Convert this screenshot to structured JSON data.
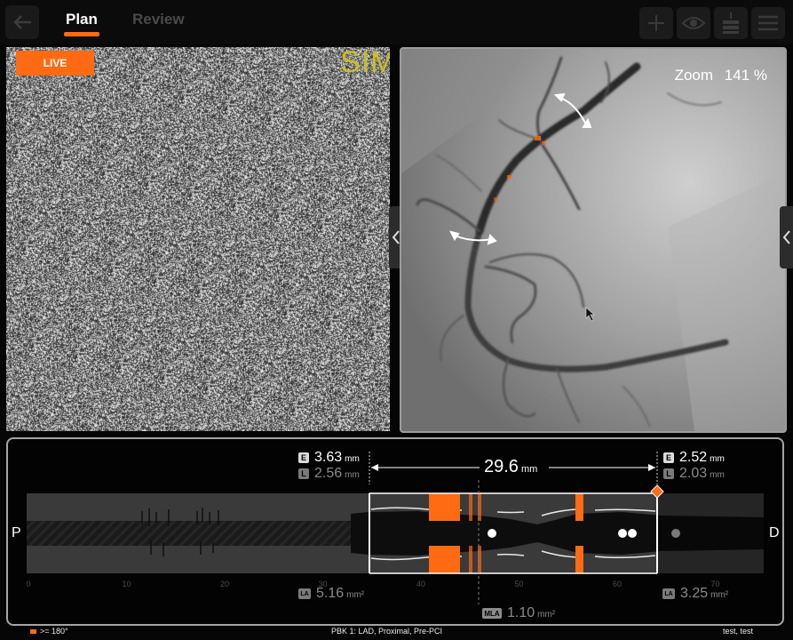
{
  "header": {
    "tabs": [
      {
        "label": "Plan",
        "active": true
      },
      {
        "label": "Review",
        "active": false
      }
    ],
    "toolbar_icons": [
      "plus-icon",
      "eye-icon",
      "layers-icon",
      "menu-icon"
    ]
  },
  "live_view": {
    "badge": "LIVE",
    "overlay_text": "SIM"
  },
  "angio_view": {
    "zoom_label": "Zoom",
    "zoom_value": "141 %"
  },
  "pullback": {
    "proximal_label": "P",
    "distal_label": "D",
    "proximal_ref": {
      "ext_badge": "E",
      "ext_value": "3.63",
      "ext_unit": "mm",
      "lumen_badge": "L",
      "lumen_value": "2.56",
      "lumen_unit": "mm",
      "area_badge": "LA",
      "area_value": "5.16",
      "area_unit": "mm²"
    },
    "distal_ref": {
      "ext_badge": "E",
      "ext_value": "2.52",
      "ext_unit": "mm",
      "lumen_badge": "L",
      "lumen_value": "2.03",
      "lumen_unit": "mm",
      "area_badge": "LA",
      "area_value": "3.25",
      "area_unit": "mm²"
    },
    "length_value": "29.6",
    "length_unit": "mm",
    "mla_badge": "MLA",
    "mla_value": "1.10",
    "mla_unit": "mm²",
    "scale_ticks": [
      "0",
      "10",
      "20",
      "30",
      "40",
      "50",
      "60",
      "70"
    ],
    "colors": {
      "accent": "#ff6a13",
      "vessel": "#0d0d0d",
      "bg": "#3a3a3a"
    }
  },
  "status_bar": {
    "left": ">= 180°",
    "middle": "PBK 1:  LAD,  Proximal,  Pre-PCI",
    "right": "test,  test"
  }
}
